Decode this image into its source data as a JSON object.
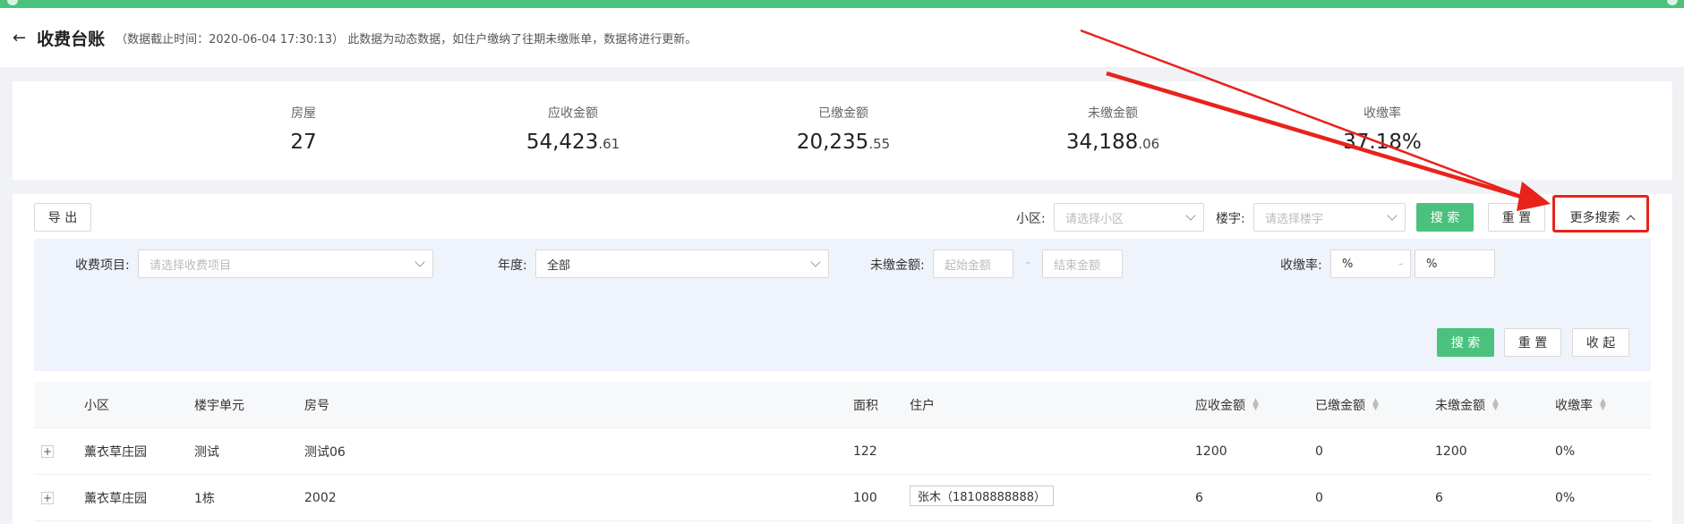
{
  "header": {
    "back_icon": "arrow-left-icon",
    "title": "收费台账",
    "note": "（数据截止时间：2020-06-04 17:30:13） 此数据为动态数据，如住户缴纳了往期未缴账单，数据将进行更新。"
  },
  "stats": [
    {
      "label": "房屋",
      "value": "27",
      "decimal": ""
    },
    {
      "label": "应收金额",
      "value": "54,423",
      "decimal": ".61"
    },
    {
      "label": "已缴金额",
      "value": "20,235",
      "decimal": ".55"
    },
    {
      "label": "未缴金额",
      "value": "34,188",
      "decimal": ".06"
    },
    {
      "label": "收缴率",
      "value": "37.18%",
      "decimal": ""
    }
  ],
  "toolbar": {
    "export_label": "导 出",
    "community_label": "小区:",
    "community_placeholder": "请选择小区",
    "building_label": "楼宇:",
    "building_placeholder": "请选择楼宇",
    "search_label": "搜 索",
    "reset_label": "重 置",
    "more_search_label": "更多搜索"
  },
  "advanced": {
    "item_label": "收费项目:",
    "item_placeholder": "请选择收费项目",
    "year_label": "年度:",
    "year_value": "全部",
    "unpaid_label": "未缴金额:",
    "unpaid_start_placeholder": "起始金额",
    "range_sep": "-",
    "unpaid_end_placeholder": "结束金额",
    "rate_label": "收缴率:",
    "rate_min": "%",
    "rate_max": "%",
    "search_label": "搜 索",
    "reset_label": "重 置",
    "collapse_label": "收 起"
  },
  "table": {
    "headers": {
      "community": "小区",
      "building": "楼宇单元",
      "room": "房号",
      "area": "面积",
      "resident": "住户",
      "receivable": "应收金额",
      "paid": "已缴金额",
      "unpaid": "未缴金额",
      "rate": "收缴率"
    },
    "rows": [
      {
        "expand": "+",
        "community": "薰衣草庄园",
        "building": "测试",
        "room": "测试06",
        "area": "122",
        "resident": "",
        "receivable": "1200",
        "paid": "0",
        "unpaid": "1200",
        "rate": "0%"
      },
      {
        "expand": "+",
        "community": "薰衣草庄园",
        "building": "1栋",
        "room": "2002",
        "area": "100",
        "resident": "张木（18108888888）",
        "receivable": "6",
        "paid": "0",
        "unpaid": "6",
        "rate": "0%"
      }
    ]
  },
  "colors": {
    "accent": "#4ac27d",
    "annotation": "#e8231a",
    "advanced_bg": "#eff3fc"
  }
}
